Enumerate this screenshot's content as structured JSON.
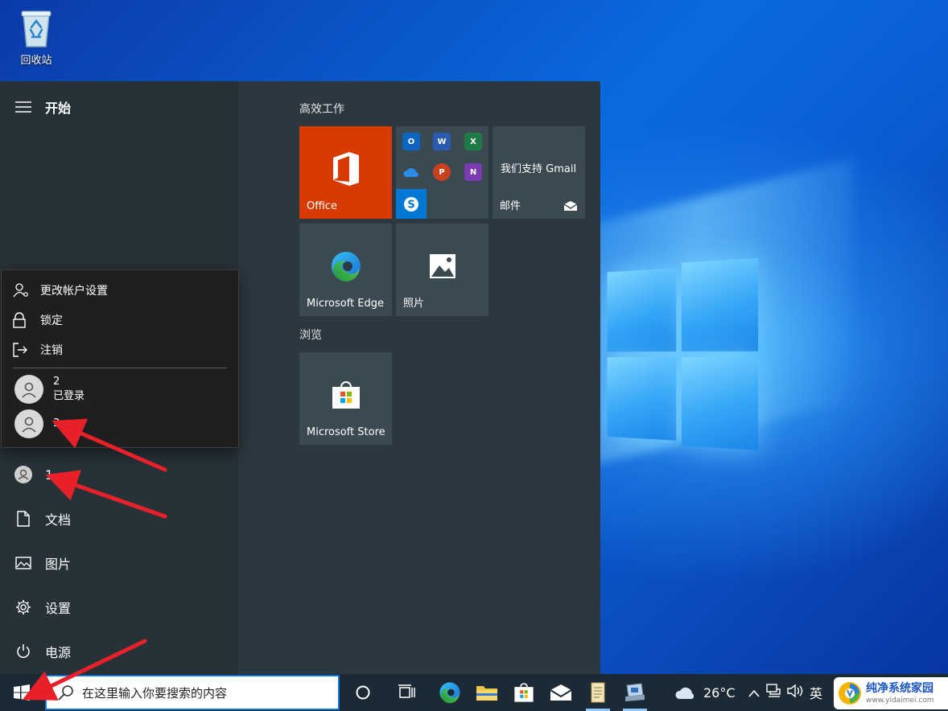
{
  "desktop": {
    "recycle_bin_label": "回收站"
  },
  "start_menu": {
    "title": "开始",
    "rail_items": {
      "user": "1",
      "documents": "文档",
      "pictures": "图片",
      "settings": "设置",
      "power": "电源"
    },
    "groups": {
      "productivity": "高效工作",
      "browse": "浏览"
    },
    "tiles": {
      "office": "Office",
      "mail_promo": "我们支持 Gmail",
      "mail": "邮件",
      "edge": "Microsoft Edge",
      "photos": "照片",
      "store": "Microsoft Store"
    }
  },
  "account_flyout": {
    "change_settings": "更改帐户设置",
    "lock": "锁定",
    "sign_out": "注销",
    "users": [
      {
        "name": "2",
        "status": "已登录"
      },
      {
        "name": "3",
        "status": ""
      }
    ]
  },
  "taskbar": {
    "search_placeholder": "在这里输入你要搜索的内容",
    "weather_temp": "26°C",
    "ime": "英"
  },
  "watermark": {
    "title": "纯净系统家园",
    "url": "www.yidaimei.com"
  },
  "colors": {
    "office_tile": "#d83b01",
    "skype_tile": "#0078d4",
    "annotation_arrow": "#e8202a"
  }
}
